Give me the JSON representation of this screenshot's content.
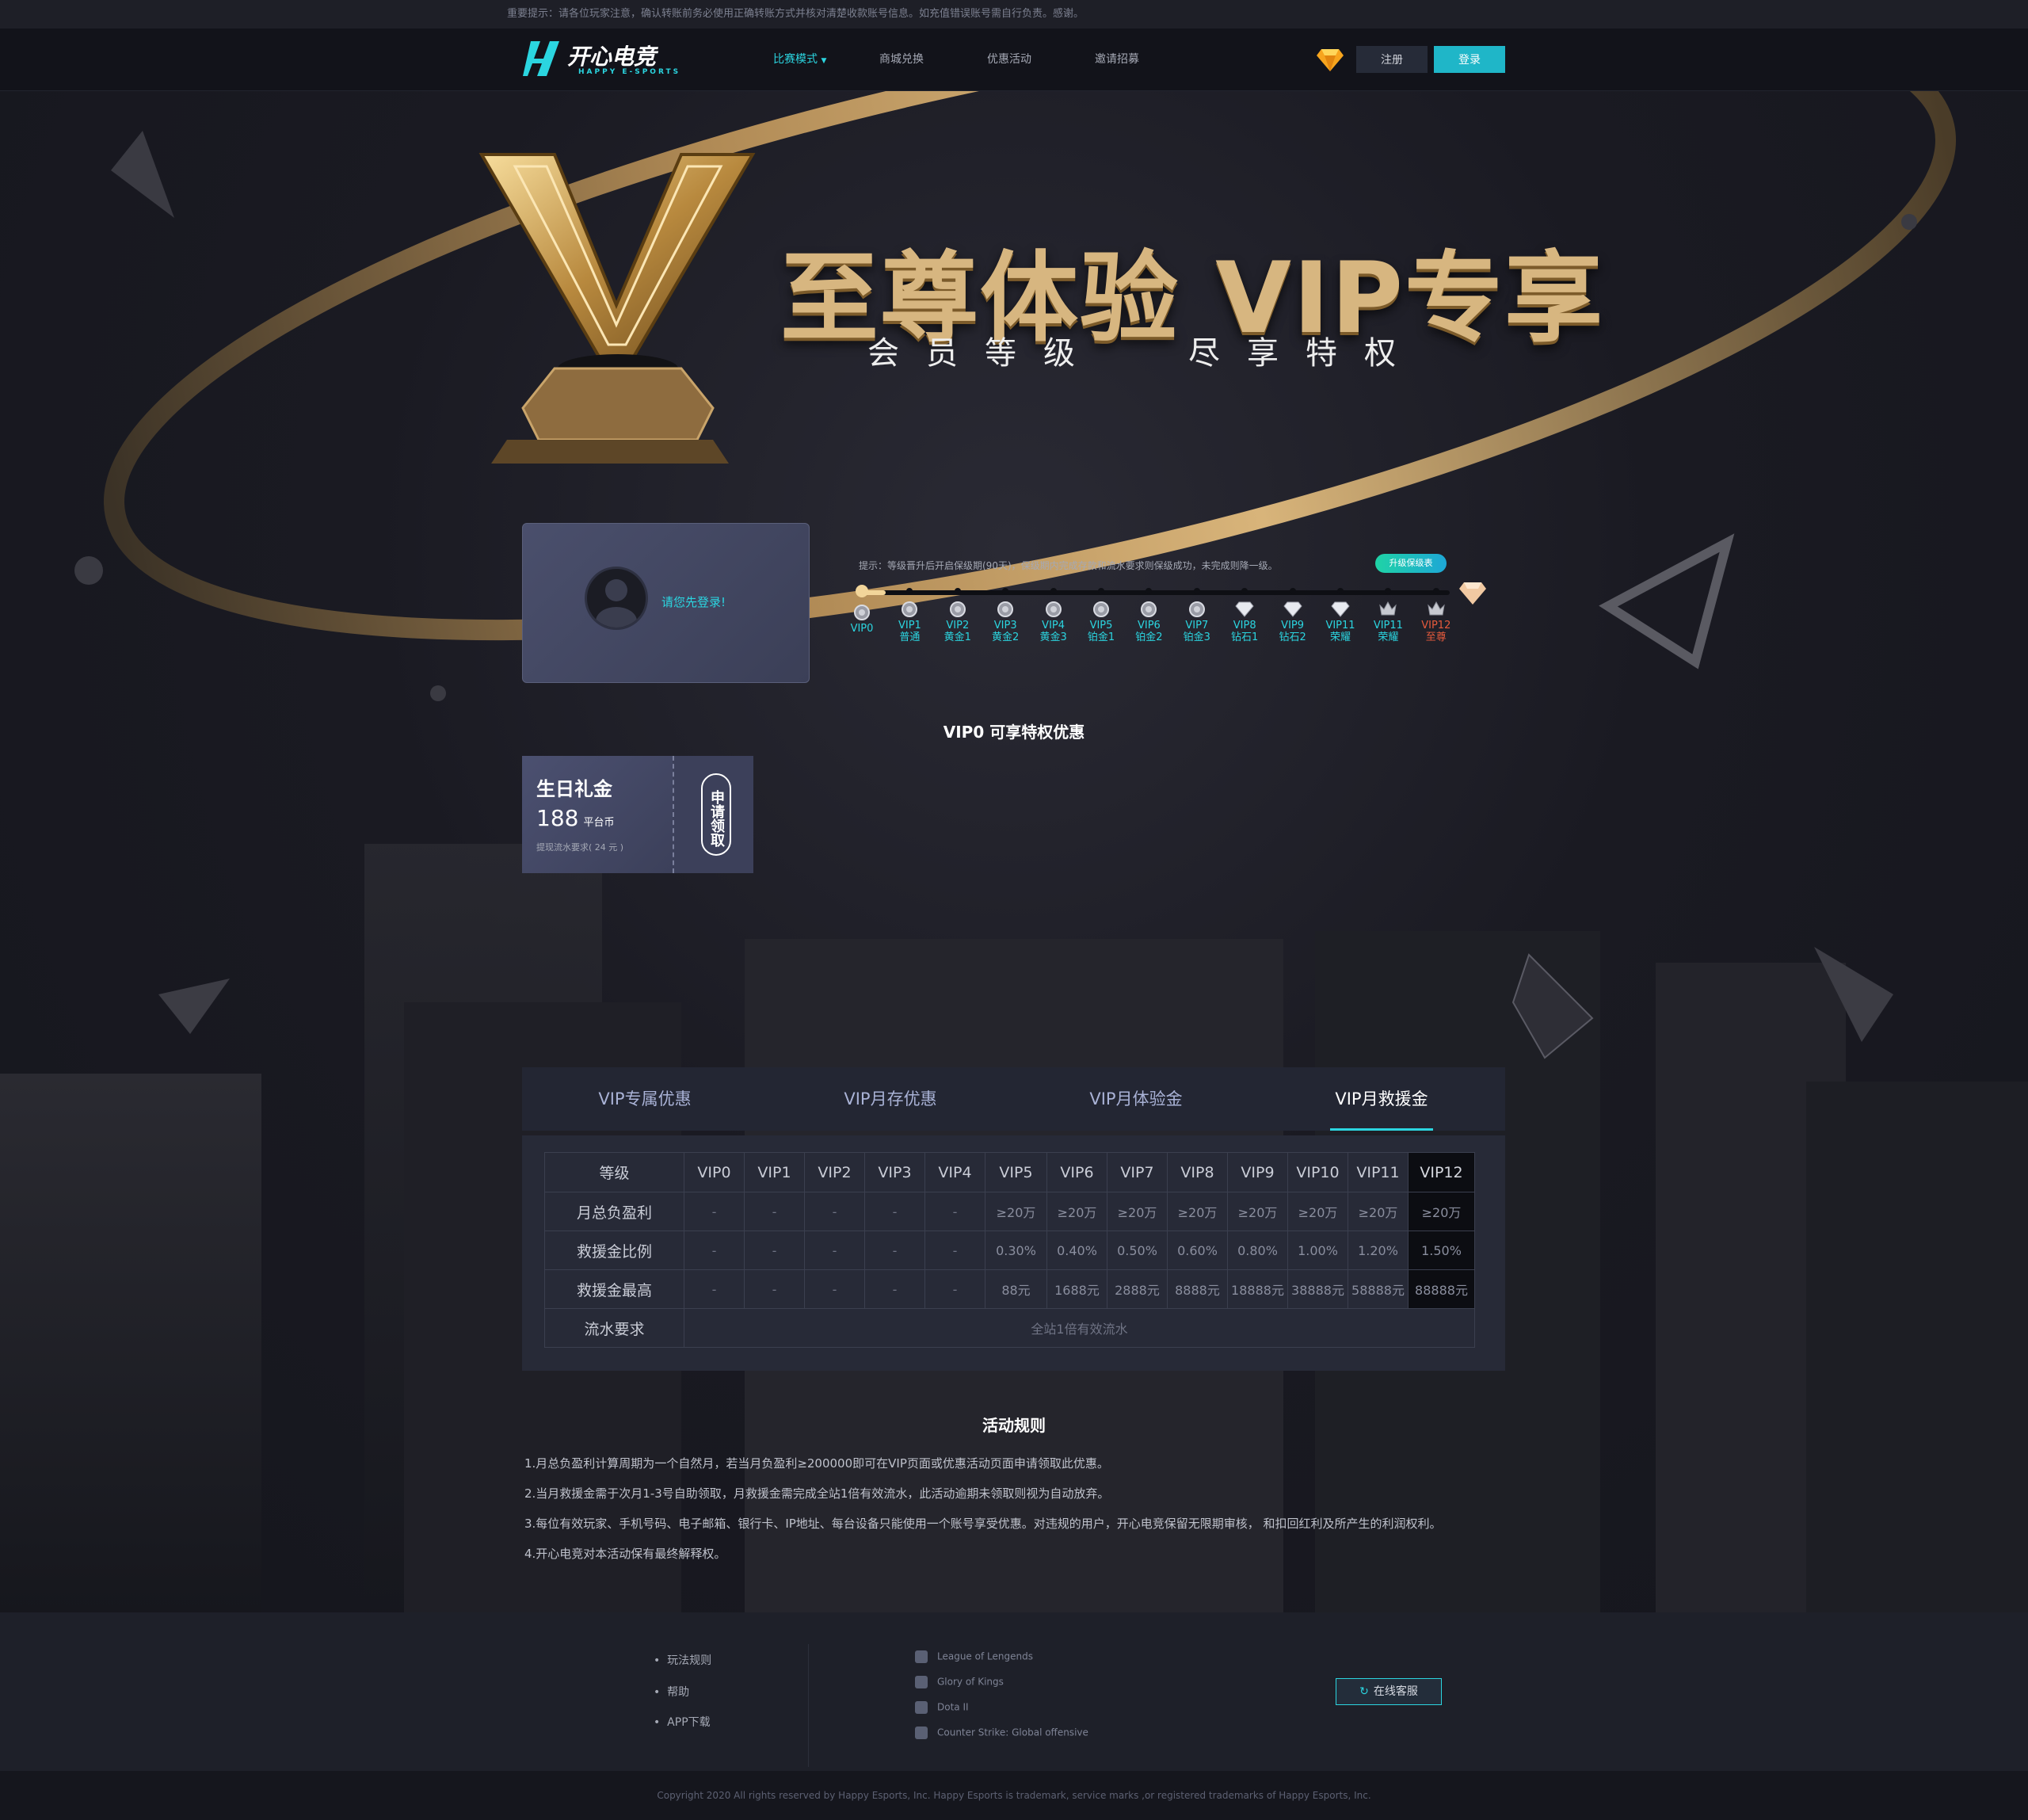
{
  "notice": "重要提示：请各位玩家注意，确认转账前务必使用正确转账方式并核对清楚收款账号信息。如充值错误账号需自行负责。感谢。",
  "header": {
    "logo_name": "开心电竞",
    "logo_sub": "HAPPY E-SPORTS",
    "nav": [
      "比赛模式",
      "商城兑换",
      "优惠活动",
      "邀请招募"
    ],
    "register": "注册",
    "login": "登录"
  },
  "hero": {
    "title": "至尊体验 VIP专享",
    "sub_left": "会员等级",
    "sub_right": "尽享特权"
  },
  "user_card": {
    "login_tip": "请您先登录!"
  },
  "vip_progress": {
    "tip": "提示：等级晋升后开启保级期(90天)，保级期内完成存款和流水要求则保级成功，未完成则降一级。",
    "keep_button": "升级保级表",
    "current_level": 0,
    "levels": [
      {
        "code": "VIP0",
        "name": ""
      },
      {
        "code": "VIP1",
        "name": "普通"
      },
      {
        "code": "VIP2",
        "name": "黄金1"
      },
      {
        "code": "VIP3",
        "name": "黄金2"
      },
      {
        "code": "VIP4",
        "name": "黄金3"
      },
      {
        "code": "VIP5",
        "name": "铂金1"
      },
      {
        "code": "VIP6",
        "name": "铂金2"
      },
      {
        "code": "VIP7",
        "name": "铂金3"
      },
      {
        "code": "VIP8",
        "name": "钻石1"
      },
      {
        "code": "VIP9",
        "name": "钻石2"
      },
      {
        "code": "VIP11",
        "name": "荣耀"
      },
      {
        "code": "VIP11",
        "name": "荣耀"
      },
      {
        "code": "VIP12",
        "name": "至尊"
      }
    ]
  },
  "privilege_title": "VIP0 可享特权优惠",
  "coupon": {
    "title": "生日礼金",
    "amount": "188",
    "unit": "平台币",
    "requirement": "提现流水要求( 24 元 )",
    "apply": "申请领取"
  },
  "tabs": [
    "VIP专属优惠",
    "VIP月存优惠",
    "VIP月体验金",
    "VIP月救援金"
  ],
  "active_tab": 3,
  "table": {
    "header": [
      "等级",
      "VIP0",
      "VIP1",
      "VIP2",
      "VIP3",
      "VIP4",
      "VIP5",
      "VIP6",
      "VIP7",
      "VIP8",
      "VIP9",
      "VIP10",
      "VIP11",
      "VIP12"
    ],
    "rows": [
      [
        "月总负盈利",
        "-",
        "-",
        "-",
        "-",
        "-",
        "≥20万",
        "≥20万",
        "≥20万",
        "≥20万",
        "≥20万",
        "≥20万",
        "≥20万",
        "≥20万"
      ],
      [
        "救援金比例",
        "-",
        "-",
        "-",
        "-",
        "-",
        "0.30%",
        "0.40%",
        "0.50%",
        "0.60%",
        "0.80%",
        "1.00%",
        "1.20%",
        "1.50%"
      ],
      [
        "救援金最高",
        "-",
        "-",
        "-",
        "-",
        "-",
        "88元",
        "1688元",
        "2888元",
        "8888元",
        "18888元",
        "38888元",
        "58888元",
        "88888元"
      ]
    ],
    "flow_label": "流水要求",
    "flow_value": "全站1倍有效流水"
  },
  "rules": {
    "title": "活动规则",
    "items": [
      "1.月总负盈利计算周期为一个自然月，若当月负盈利≥200000即可在VIP页面或优惠活动页面申请领取此优惠。",
      "2.当月救援金需于次月1-3号自助领取，月救援金需完成全站1倍有效流水，此活动逾期未领取则视为自动放弃。",
      "3.每位有效玩家、手机号码、电子邮箱、银行卡、IP地址、每台设备只能使用一个账号享受优惠。对违规的用户，开心电竞保留无限期审核， 和扣回红利及所产生的利润权利。",
      "4.开心电竞对本活动保有最终解释权。"
    ]
  },
  "footer": {
    "links": [
      "玩法规则",
      "帮助",
      "APP下载"
    ],
    "games": [
      "League of Lengends",
      "Glory of Kings",
      "Dota II",
      "Counter Strike: Global offensive"
    ],
    "service": "在线客服",
    "copyright": "Copyright 2020 All rights reserved by Happy Esports, Inc. Happy Esports is trademark, service marks ,or registered trademarks of Happy Esports, Inc."
  },
  "colors": {
    "accent": "#2bd5e0",
    "gold": "#d7b680",
    "vip12": "#e65a3c"
  }
}
